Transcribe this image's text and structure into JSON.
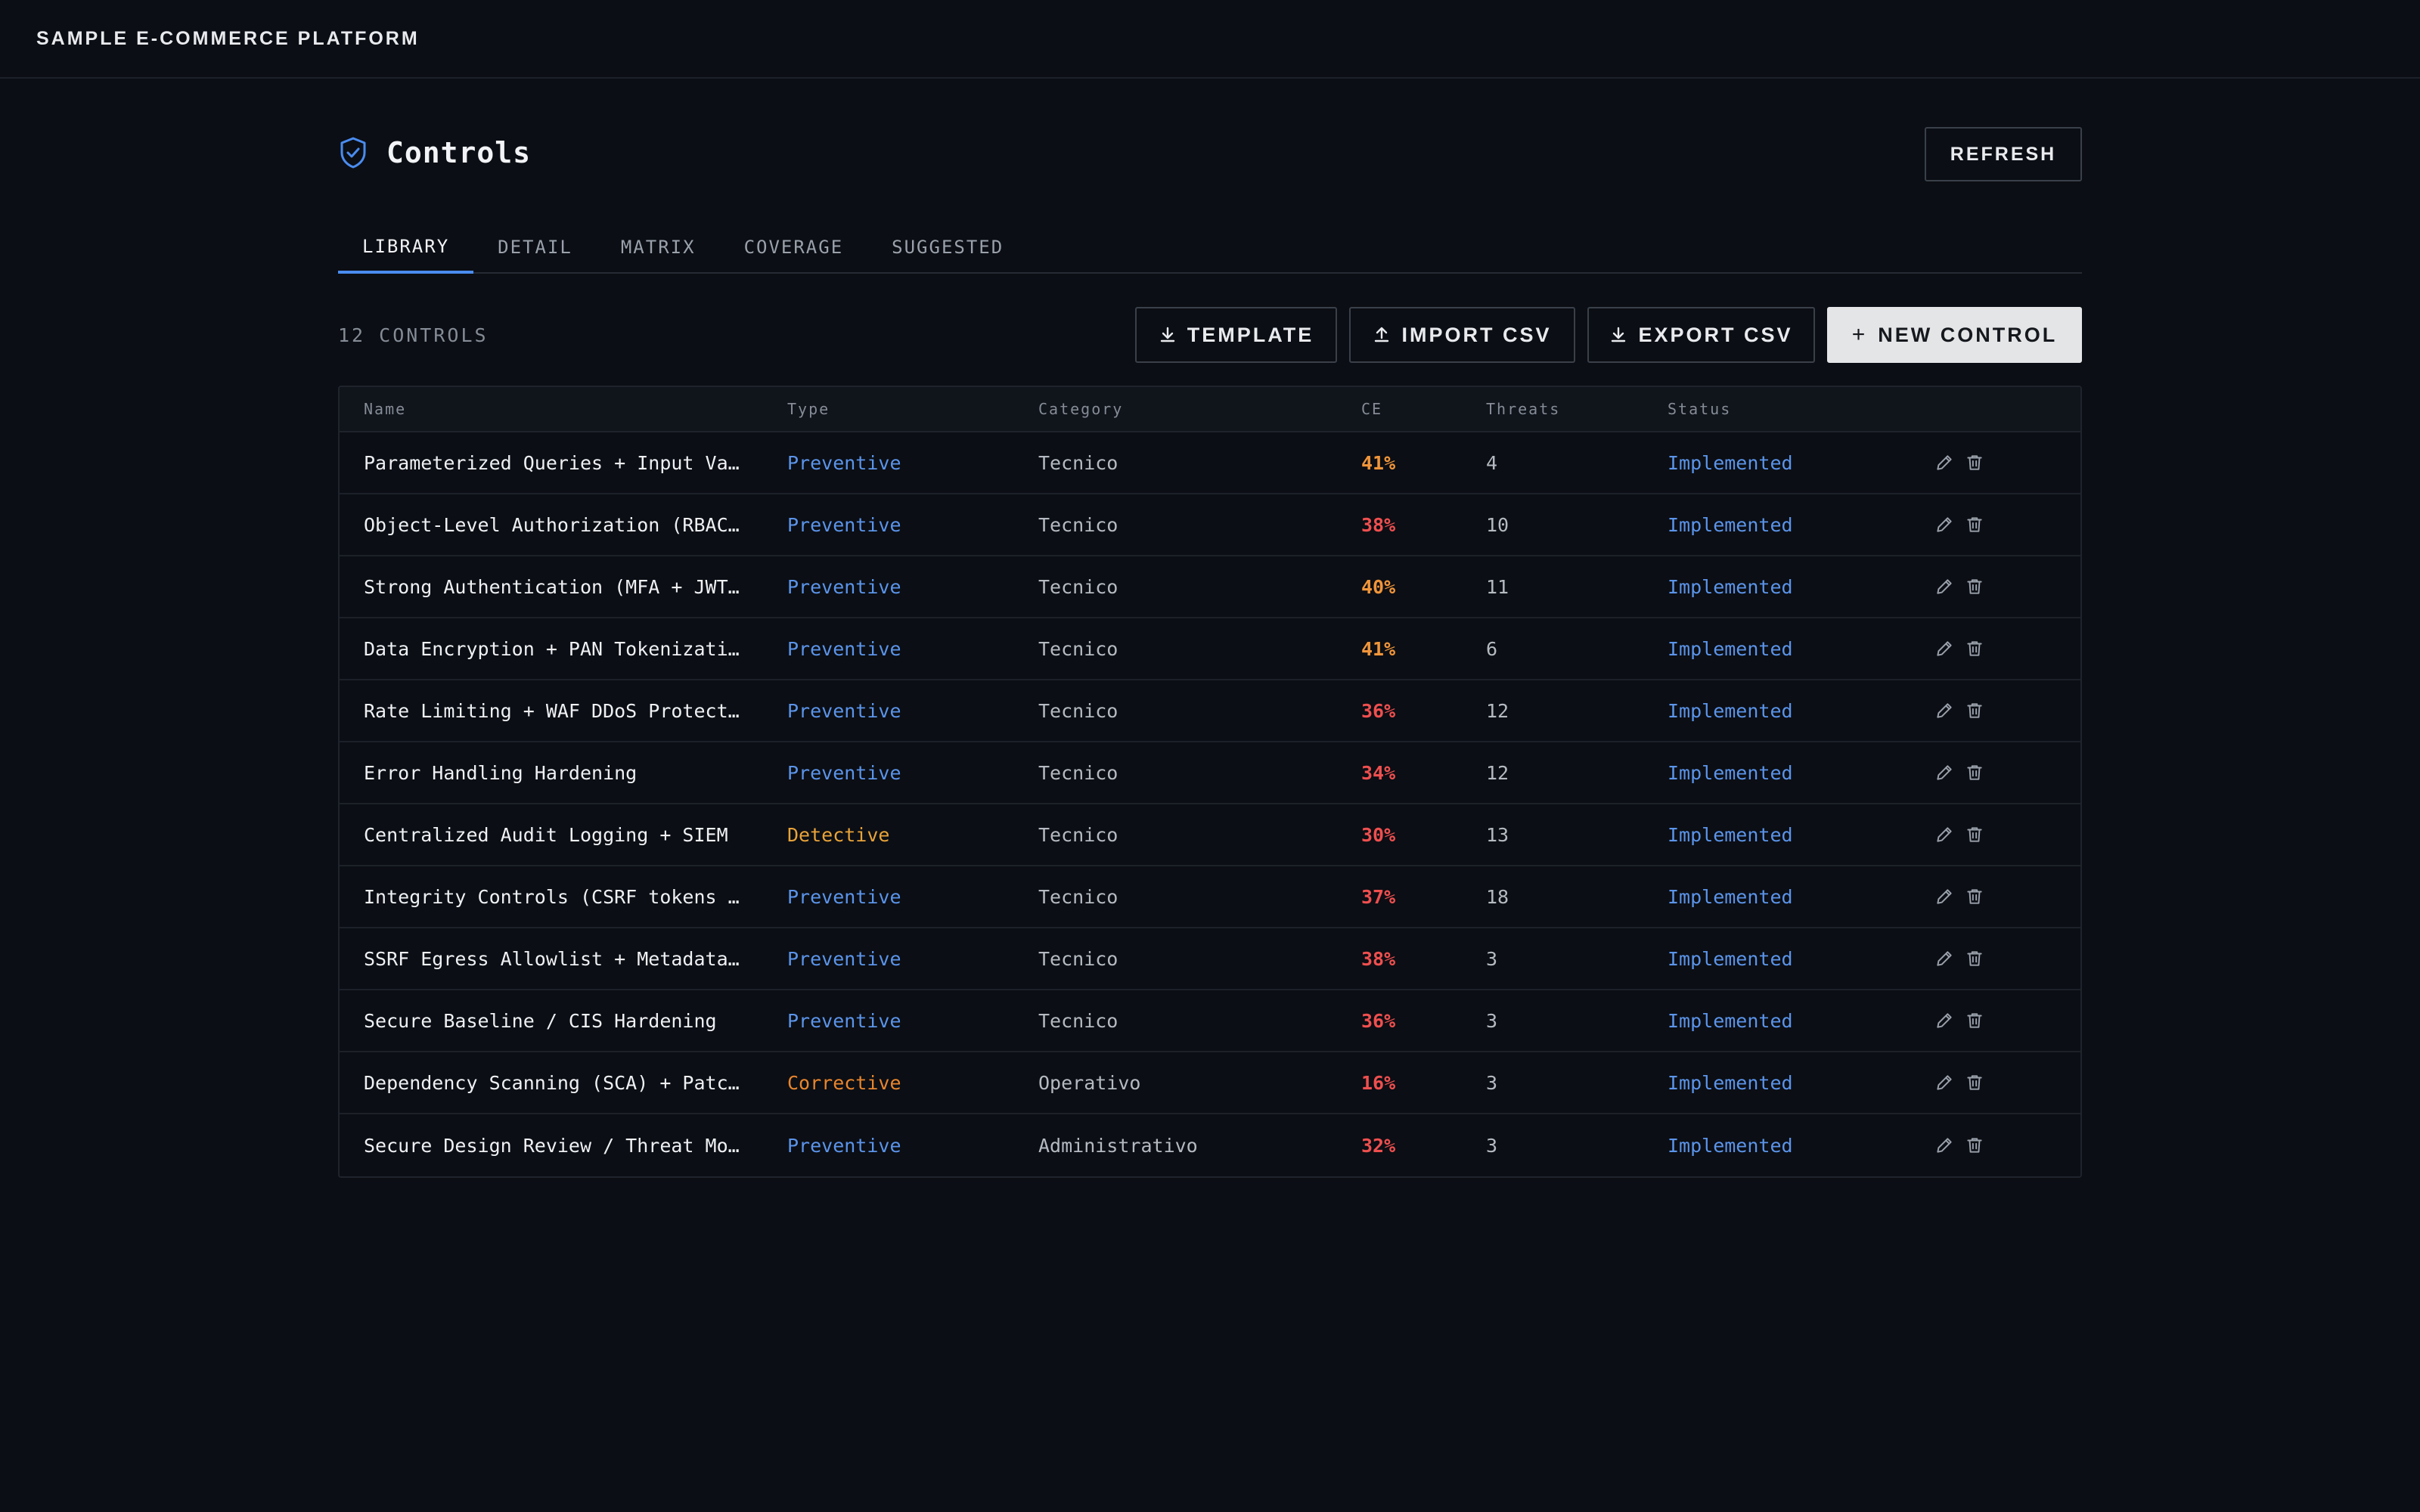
{
  "app": {
    "brand": "SAMPLE E-COMMERCE PLATFORM"
  },
  "header": {
    "title": "Controls",
    "icon": "shield-check-icon",
    "refresh_label": "REFRESH"
  },
  "tabs": [
    {
      "label": "LIBRARY",
      "active": true
    },
    {
      "label": "DETAIL",
      "active": false
    },
    {
      "label": "MATRIX",
      "active": false
    },
    {
      "label": "COVERAGE",
      "active": false
    },
    {
      "label": "SUGGESTED",
      "active": false
    }
  ],
  "toolbar": {
    "count_label": "12 CONTROLS",
    "template_label": "TEMPLATE",
    "import_label": "IMPORT CSV",
    "export_label": "EXPORT CSV",
    "new_label": "NEW CONTROL"
  },
  "table": {
    "columns": [
      "Name",
      "Type",
      "Category",
      "CE",
      "Threats",
      "Status"
    ],
    "rows": [
      {
        "name": "Parameterized Queries + Input Va…",
        "type": "Preventive",
        "category": "Tecnico",
        "ce": "41%",
        "threats": "4",
        "status": "Implemented"
      },
      {
        "name": "Object-Level Authorization (RBAC…",
        "type": "Preventive",
        "category": "Tecnico",
        "ce": "38%",
        "threats": "10",
        "status": "Implemented"
      },
      {
        "name": "Strong Authentication (MFA + JWT…",
        "type": "Preventive",
        "category": "Tecnico",
        "ce": "40%",
        "threats": "11",
        "status": "Implemented"
      },
      {
        "name": "Data Encryption + PAN Tokenizati…",
        "type": "Preventive",
        "category": "Tecnico",
        "ce": "41%",
        "threats": "6",
        "status": "Implemented"
      },
      {
        "name": "Rate Limiting + WAF DDoS Protect…",
        "type": "Preventive",
        "category": "Tecnico",
        "ce": "36%",
        "threats": "12",
        "status": "Implemented"
      },
      {
        "name": "Error Handling Hardening",
        "type": "Preventive",
        "category": "Tecnico",
        "ce": "34%",
        "threats": "12",
        "status": "Implemented"
      },
      {
        "name": "Centralized Audit Logging + SIEM",
        "type": "Detective",
        "category": "Tecnico",
        "ce": "30%",
        "threats": "13",
        "status": "Implemented"
      },
      {
        "name": "Integrity Controls (CSRF tokens …",
        "type": "Preventive",
        "category": "Tecnico",
        "ce": "37%",
        "threats": "18",
        "status": "Implemented"
      },
      {
        "name": "SSRF Egress Allowlist + Metadata…",
        "type": "Preventive",
        "category": "Tecnico",
        "ce": "38%",
        "threats": "3",
        "status": "Implemented"
      },
      {
        "name": "Secure Baseline / CIS Hardening",
        "type": "Preventive",
        "category": "Tecnico",
        "ce": "36%",
        "threats": "3",
        "status": "Implemented"
      },
      {
        "name": "Dependency Scanning (SCA) + Patc…",
        "type": "Corrective",
        "category": "Operativo",
        "ce": "16%",
        "threats": "3",
        "status": "Implemented"
      },
      {
        "name": "Secure Design Review / Threat Mo…",
        "type": "Preventive",
        "category": "Administrativo",
        "ce": "32%",
        "threats": "3",
        "status": "Implemented"
      }
    ]
  },
  "colors": {
    "accent": "#4a8cf0",
    "preventive": "#5b94ea",
    "detective": "#e8a33a",
    "corrective": "#e8852e",
    "ce_high": "#f0953a",
    "ce_low": "#ef4f4f"
  }
}
